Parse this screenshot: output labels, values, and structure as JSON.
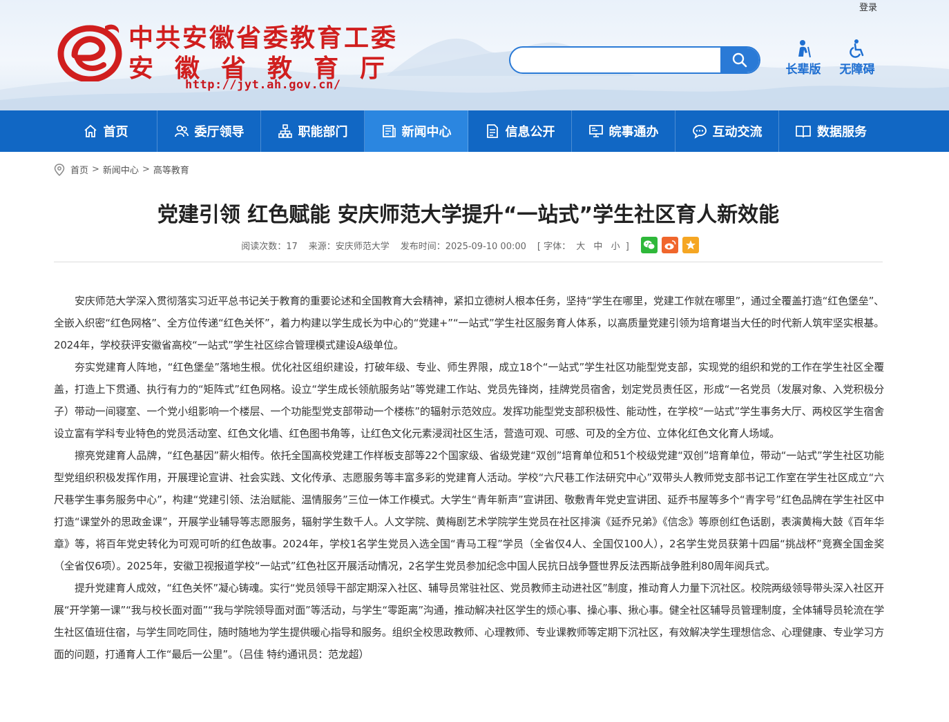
{
  "header": {
    "login": "登录",
    "title_line1": "中共安徽省委教育工委",
    "title_line2": "安徽省教育厅",
    "site_url": "http://jyt.ah.gov.cn/",
    "search_placeholder": "",
    "tools": [
      {
        "label": "长辈版",
        "icon": "elder-icon"
      },
      {
        "label": "无障碍",
        "icon": "wheelchair-icon"
      }
    ]
  },
  "nav": {
    "items": [
      {
        "label": "首页",
        "icon": "home-icon"
      },
      {
        "label": "委厅领导",
        "icon": "people-icon"
      },
      {
        "label": "职能部门",
        "icon": "org-chart-icon"
      },
      {
        "label": "新闻中心",
        "icon": "news-icon",
        "active": true
      },
      {
        "label": "信息公开",
        "icon": "document-icon"
      },
      {
        "label": "皖事通办",
        "icon": "service-icon"
      },
      {
        "label": "互动交流",
        "icon": "chat-icon"
      },
      {
        "label": "数据服务",
        "icon": "book-icon"
      }
    ],
    "active_color": "#2b86e0",
    "bar_color": "#1167c4"
  },
  "breadcrumb": [
    "首页",
    "新闻中心",
    "高等教育"
  ],
  "article": {
    "title": "党建引领 红色赋能 安庆师范大学提升“一站式”学生社区育人新效能",
    "meta": {
      "views": "阅读次数：17",
      "source": "来源：安庆师范大学",
      "date": "发布时间：2025-09-10 00:00",
      "font_label": "[ 字体：",
      "font_large": "大",
      "font_medium": "中",
      "font_small": "小",
      "font_close": "]"
    },
    "share": [
      {
        "name": "wechat-share",
        "color": "#2fb83a"
      },
      {
        "name": "weibo-share",
        "color": "#f0662c"
      },
      {
        "name": "favorite-share",
        "color": "#f5a623"
      }
    ],
    "paragraphs": [
      "安庆师范大学深入贯彻落实习近平总书记关于教育的重要论述和全国教育大会精神，紧扣立德树人根本任务，坚持“学生在哪里，党建工作就在哪里”，通过全覆盖打造“红色堡垒”、全嵌入织密“红色网格”、全方位传递“红色关怀”，着力构建以学生成长为中心的“党建+”“一站式”学生社区服务育人体系，以高质量党建引领为培育堪当大任的时代新人筑牢坚实根基。2024年，学校获评安徽省高校“一站式”学生社区综合管理模式建设A级单位。",
      "夯实党建育人阵地，“红色堡垒”落地生根。优化社区组织建设，打破年级、专业、师生界限，成立18个“一站式”学生社区功能型党支部，实现党的组织和党的工作在学生社区全覆盖，打造上下贯通、执行有力的“矩阵式”红色网格。设立“学生成长领航服务站”等党建工作站、党员先锋岗，挂牌党员宿舍，划定党员责任区，形成“一名党员（发展对象、入党积极分子）带动一间寝室、一个党小组影响一个楼层、一个功能型党支部带动一个楼栋”的辐射示范效应。发挥功能型党支部积极性、能动性，在学校“一站式”学生事务大厅、两校区学生宿舍设立富有学科专业特色的党员活动室、红色文化墙、红色图书角等，让红色文化元素浸润社区生活，营造可观、可感、可及的全方位、立体化红色文化育人场域。",
      "擦亮党建育人品牌，“红色基因”薪火相传。依托全国高校党建工作样板支部等22个国家级、省级党建“双创”培育单位和51个校级党建“双创”培育单位，带动“一站式”学生社区功能型党组织积极发挥作用，开展理论宣讲、社会实践、文化传承、志愿服务等丰富多彩的党建育人活动。学校“六尺巷工作法研究中心”双带头人教师党支部书记工作室在学生社区成立“六尺巷学生事务服务中心”，构建“党建引领、法治赋能、温情服务”三位一体工作模式。大学生“青年新声”宣讲团、敬敷青年党史宣讲团、延乔书屋等多个“青字号”红色品牌在学生社区中打造“课堂外的思政金课”，开展学业辅导等志愿服务，辐射学生数千人。人文学院、黄梅剧艺术学院学生党员在社区排演《延乔兄弟》《信念》等原创红色话剧，表演黄梅大鼓《百年华章》等，将百年党史转化为可观可听的红色故事。2024年，学校1名学生党员入选全国“青马工程”学员（全省仅4人、全国仅100人），2名学生党员获第十四届“挑战杯”竞赛全国金奖（全省仅6项）。2025年，安徽卫视报道学校“一站式”红色社区开展活动情况，2名学生党员参加纪念中国人民抗日战争暨世界反法西斯战争胜利80周年阅兵式。",
      "提升党建育人成效，“红色关怀”凝心铸魂。实行“党员领导干部定期深入社区、辅导员常驻社区、党员教师主动进社区”制度，推动育人力量下沉社区。校院两级领导带头深入社区开展“开学第一课”“我与校长面对面”“我与学院领导面对面”等活动，与学生“零距离”沟通，推动解决社区学生的烦心事、操心事、揪心事。健全社区辅导员管理制度，全体辅导员轮流在学生社区值班住宿，与学生同吃同住，随时随地为学生提供暖心指导和服务。组织全校思政教师、心理教师、专业课教师等定期下沉社区，有效解决学生理想信念、心理健康、专业学习方面的问题，打通育人工作“最后一公里”。（吕佳 特约通讯员：范龙超）"
    ]
  }
}
